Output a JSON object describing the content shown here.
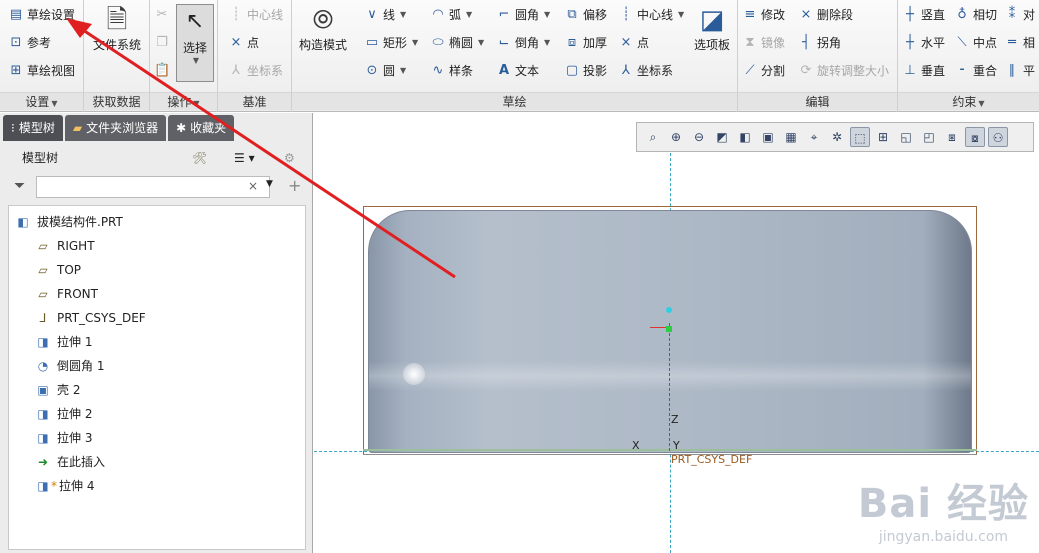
{
  "ribbon": {
    "settings": {
      "title": "设置",
      "sketch_setup": "草绘设置",
      "reference": "参考",
      "sketch_view": "草绘视图"
    },
    "getdata": {
      "title": "获取数据",
      "file_system": "文件系统"
    },
    "operations": {
      "title": "操作",
      "select": "选择"
    },
    "datum": {
      "title": "基准",
      "centerline": "中心线",
      "point": "点",
      "coord": "坐标系"
    },
    "sketch": {
      "title": "草绘",
      "construction": "构造模式",
      "line": "线",
      "rectangle": "矩形",
      "circle": "圆",
      "arc": "弧",
      "ellipse": "椭圆",
      "spline": "样条",
      "fillet": "圆角",
      "chamfer": "倒角",
      "text": "文本",
      "offset": "偏移",
      "thicken": "加厚",
      "project": "投影",
      "centerline": "中心线",
      "point": "点",
      "coord": "坐标系",
      "palette": "选项板"
    },
    "edit": {
      "title": "编辑",
      "modify": "修改",
      "delete_segment": "删除段",
      "mirror": "镜像",
      "corner": "拐角",
      "divide": "分割",
      "rotate_resize": "旋转调整大小"
    },
    "constrain": {
      "title": "约束",
      "vertical": "竖直",
      "tangent": "相切",
      "symmetric": "对",
      "horizontal": "水平",
      "midpoint": "中点",
      "equal": "相",
      "perpendicular": "垂直",
      "coincident": "重合",
      "parallel": "平"
    }
  },
  "leftpanel": {
    "tabs": [
      "模型树",
      "文件夹浏览器",
      "收藏夹"
    ],
    "tree_header": "模型树",
    "filter_placeholder": "",
    "items": [
      {
        "label": "拔模结构件.PRT",
        "icon": "part-icon"
      },
      {
        "label": "RIGHT",
        "icon": "datum-plane-icon"
      },
      {
        "label": "TOP",
        "icon": "datum-plane-icon"
      },
      {
        "label": "FRONT",
        "icon": "datum-plane-icon"
      },
      {
        "label": "PRT_CSYS_DEF",
        "icon": "csys-icon"
      },
      {
        "label": "拉伸 1",
        "icon": "extrude-icon"
      },
      {
        "label": "倒圆角 1",
        "icon": "round-icon"
      },
      {
        "label": "壳 2",
        "icon": "shell-icon"
      },
      {
        "label": "拉伸 2",
        "icon": "extrude-icon"
      },
      {
        "label": "拉伸 3",
        "icon": "extrude-icon"
      },
      {
        "label": "在此插入",
        "icon": "insert-here-icon"
      },
      {
        "label": "拉伸 4",
        "icon": "extrude-active-icon"
      }
    ]
  },
  "canvas": {
    "csys_label": "PRT_CSYS_DEF",
    "axis_z": "Z",
    "axis_x": "X",
    "axis_y": "Y"
  },
  "watermark": {
    "line1": "Bai 经验",
    "line2": "jingyan.baidu.com"
  },
  "colors": {
    "annotation_arrow": "#e02020",
    "dash_line": "#3aa6c6"
  }
}
